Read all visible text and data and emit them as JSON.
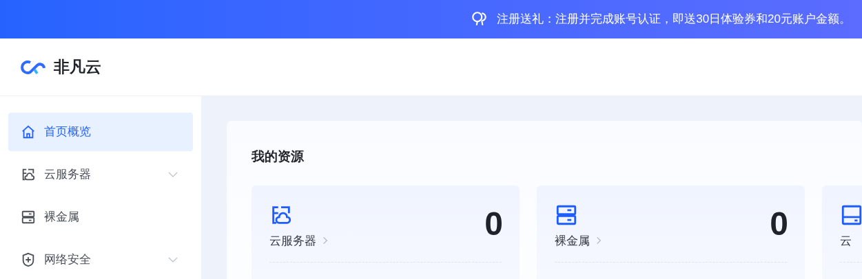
{
  "banner": {
    "text": "注册送礼：注册并完成账号认证，即送30日体验券和20元账户金额。"
  },
  "brand": {
    "name": "非凡云"
  },
  "sidebar": {
    "items": [
      {
        "label": "首页概览",
        "kind": "home",
        "selected": true,
        "expandable": false
      },
      {
        "label": "云服务器",
        "kind": "cloud-server",
        "selected": false,
        "expandable": true
      },
      {
        "label": "裸金属",
        "kind": "server",
        "selected": false,
        "expandable": false
      },
      {
        "label": "网络安全",
        "kind": "shield",
        "selected": false,
        "expandable": true
      }
    ]
  },
  "resources": {
    "title": "我的资源",
    "cards": [
      {
        "label": "云服务器",
        "kind": "cloud-server",
        "count": "0"
      },
      {
        "label": "裸金属",
        "kind": "server",
        "count": "0"
      },
      {
        "label": "云",
        "kind": "disk"
      }
    ]
  }
}
